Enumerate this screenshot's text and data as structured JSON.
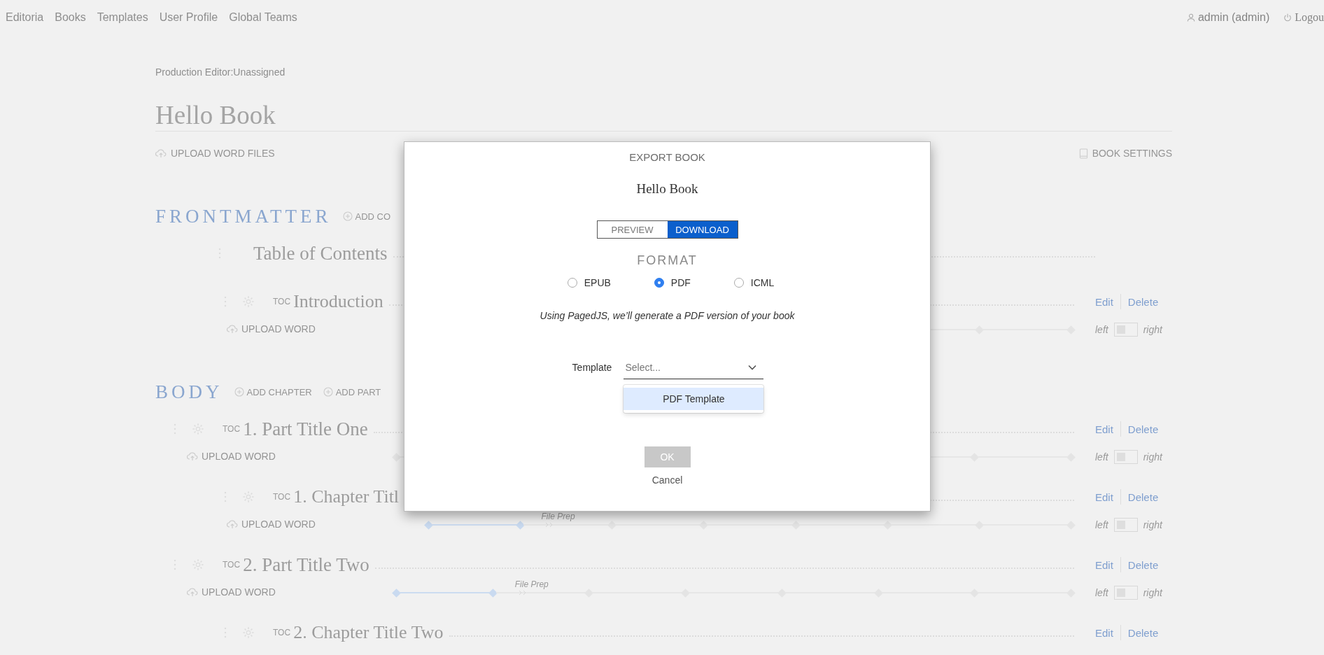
{
  "nav": {
    "links": [
      {
        "label": "Editoria"
      },
      {
        "label": "Books"
      },
      {
        "label": "Templates"
      },
      {
        "label": "User Profile"
      },
      {
        "label": "Global Teams"
      }
    ],
    "user": "admin (admin)",
    "logout": "Logou"
  },
  "production_editor": "Production Editor:Unassigned",
  "book_title": "Hello Book",
  "toolbar": {
    "upload": "UPLOAD WORD FILES",
    "settings": "BOOK SETTINGS"
  },
  "sections": [
    {
      "heading": "FRONTMATTER",
      "actions": [
        "ADD CO"
      ],
      "items": [
        {
          "kind": "toc",
          "title": "Table of Contents"
        },
        {
          "kind": "chapter",
          "toc": "TOC",
          "title": "Introduction",
          "upload": "UPLOAD WORD",
          "edit": "Edit",
          "delete": "Delete",
          "left": "left",
          "right": "right",
          "on": false
        }
      ]
    },
    {
      "heading": "BODY",
      "actions": [
        "ADD CHAPTER",
        "ADD PART"
      ],
      "items": [
        {
          "kind": "part",
          "toc": "TOC",
          "title": "1. Part Title One",
          "upload": "UPLOAD WORD",
          "edit": "Edit",
          "delete": "Delete",
          "left": "left",
          "right": "right",
          "on": false
        },
        {
          "kind": "chapter",
          "toc": "TOC",
          "title": "1. Chapter Titl",
          "upload": "UPLOAD WORD",
          "edit": "Edit",
          "delete": "Delete",
          "left": "left",
          "right": "right",
          "on": false,
          "stages": [
            {
              "done": true
            },
            {
              "done": true
            },
            {
              "done": false,
              "label": "File Prep"
            },
            {
              "done": false
            },
            {
              "done": false
            },
            {
              "done": false
            },
            {
              "done": false
            },
            {
              "done": false
            }
          ]
        },
        {
          "kind": "part",
          "toc": "TOC",
          "title": "2. Part Title Two",
          "upload": "UPLOAD WORD",
          "edit": "Edit",
          "delete": "Delete",
          "left": "left",
          "right": "right",
          "on": false,
          "stages": [
            {
              "done": true
            },
            {
              "done": true
            },
            {
              "done": false,
              "label": "File Prep"
            },
            {
              "done": false
            },
            {
              "done": false
            },
            {
              "done": false
            },
            {
              "done": false
            },
            {
              "done": false
            }
          ]
        },
        {
          "kind": "chapter",
          "toc": "TOC",
          "title": "2. Chapter Title Two",
          "edit": "Edit",
          "delete": "Delete"
        }
      ]
    }
  ],
  "modal": {
    "title": "EXPORT BOOK",
    "book": "Hello Book",
    "tabs": [
      {
        "label": "PREVIEW",
        "selected": false
      },
      {
        "label": "DOWNLOAD",
        "selected": true
      }
    ],
    "format_heading": "FORMAT",
    "formats": [
      {
        "label": "EPUB",
        "selected": false
      },
      {
        "label": "PDF",
        "selected": true
      },
      {
        "label": "ICML",
        "selected": false
      }
    ],
    "description": "Using PagedJS, we’ll generate a PDF version of your book",
    "template": {
      "label": "Template",
      "placeholder": "Select...",
      "options": [
        {
          "label": "PDF Template",
          "selected": true
        }
      ]
    },
    "ok": {
      "label": "OK",
      "disabled": true
    },
    "cancel": "Cancel"
  }
}
